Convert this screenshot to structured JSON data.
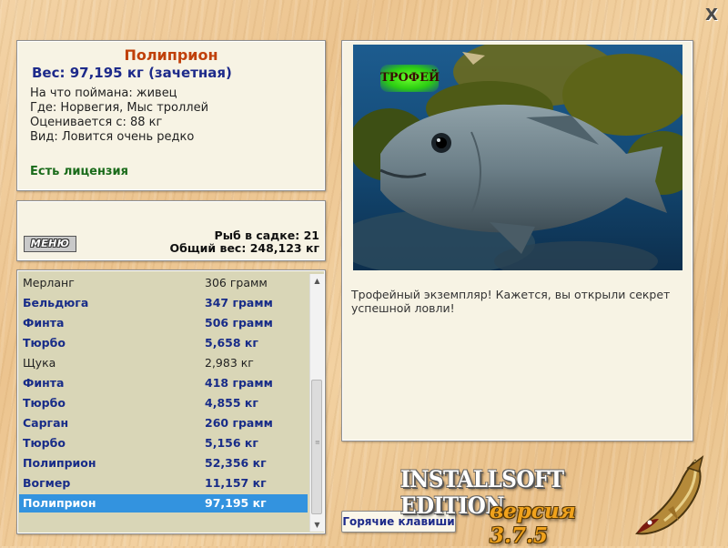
{
  "window": {
    "close_glyph": "X"
  },
  "info": {
    "title": "Полиприон",
    "weight": "Вес: 97,195 кг (зачетная)",
    "caught_on": "На что поймана: живец",
    "location": "Где: Норвегия, Мыс троллей",
    "valued_from": "Оценивается с: 88 кг",
    "rarity": "Вид: Ловится очень редко",
    "license": "Есть лицензия"
  },
  "stats": {
    "menu_label": "МЕНЮ",
    "fish_count": "Рыб в садке: 21",
    "total_weight": "Общий вес: 248,123 кг"
  },
  "catch_list": [
    {
      "name": "Мерланг",
      "weight": "306 грамм",
      "style": "plain"
    },
    {
      "name": "Бельдюга",
      "weight": "347 грамм",
      "style": "bold"
    },
    {
      "name": "Финта",
      "weight": "506 грамм",
      "style": "bold"
    },
    {
      "name": "Тюрбо",
      "weight": "5,658 кг",
      "style": "bold"
    },
    {
      "name": "Щука",
      "weight": "2,983 кг",
      "style": "plain"
    },
    {
      "name": "Финта",
      "weight": "418 грамм",
      "style": "bold"
    },
    {
      "name": "Тюрбо",
      "weight": "4,855 кг",
      "style": "bold"
    },
    {
      "name": "Сарган",
      "weight": "260 грамм",
      "style": "bold"
    },
    {
      "name": "Тюрбо",
      "weight": "5,156 кг",
      "style": "bold"
    },
    {
      "name": "Полиприон",
      "weight": "52,356 кг",
      "style": "bold"
    },
    {
      "name": "Вогмер",
      "weight": "11,157 кг",
      "style": "bold"
    },
    {
      "name": "Полиприон",
      "weight": "97,195 кг",
      "style": "selected"
    }
  ],
  "photo": {
    "badge": "ТРОФЕЙ"
  },
  "description": "Трофейный экземпляр! Кажется, вы открыли секрет успешной ловли!",
  "hotkeys_label": "Горячие клавиши",
  "brand": {
    "title": "INSTALLSOFT EDITION",
    "version": "версия 3.7.5"
  },
  "colors": {
    "selected_row": "#3393df",
    "title_orange": "#c0400a",
    "bold_blue": "#182c88",
    "license_green": "#1a6b1a"
  },
  "icons": {
    "close": "close-icon",
    "logo": "pike-fish-logo",
    "scroll_up": "scroll-up-arrow-icon",
    "scroll_down": "scroll-down-arrow-icon"
  }
}
